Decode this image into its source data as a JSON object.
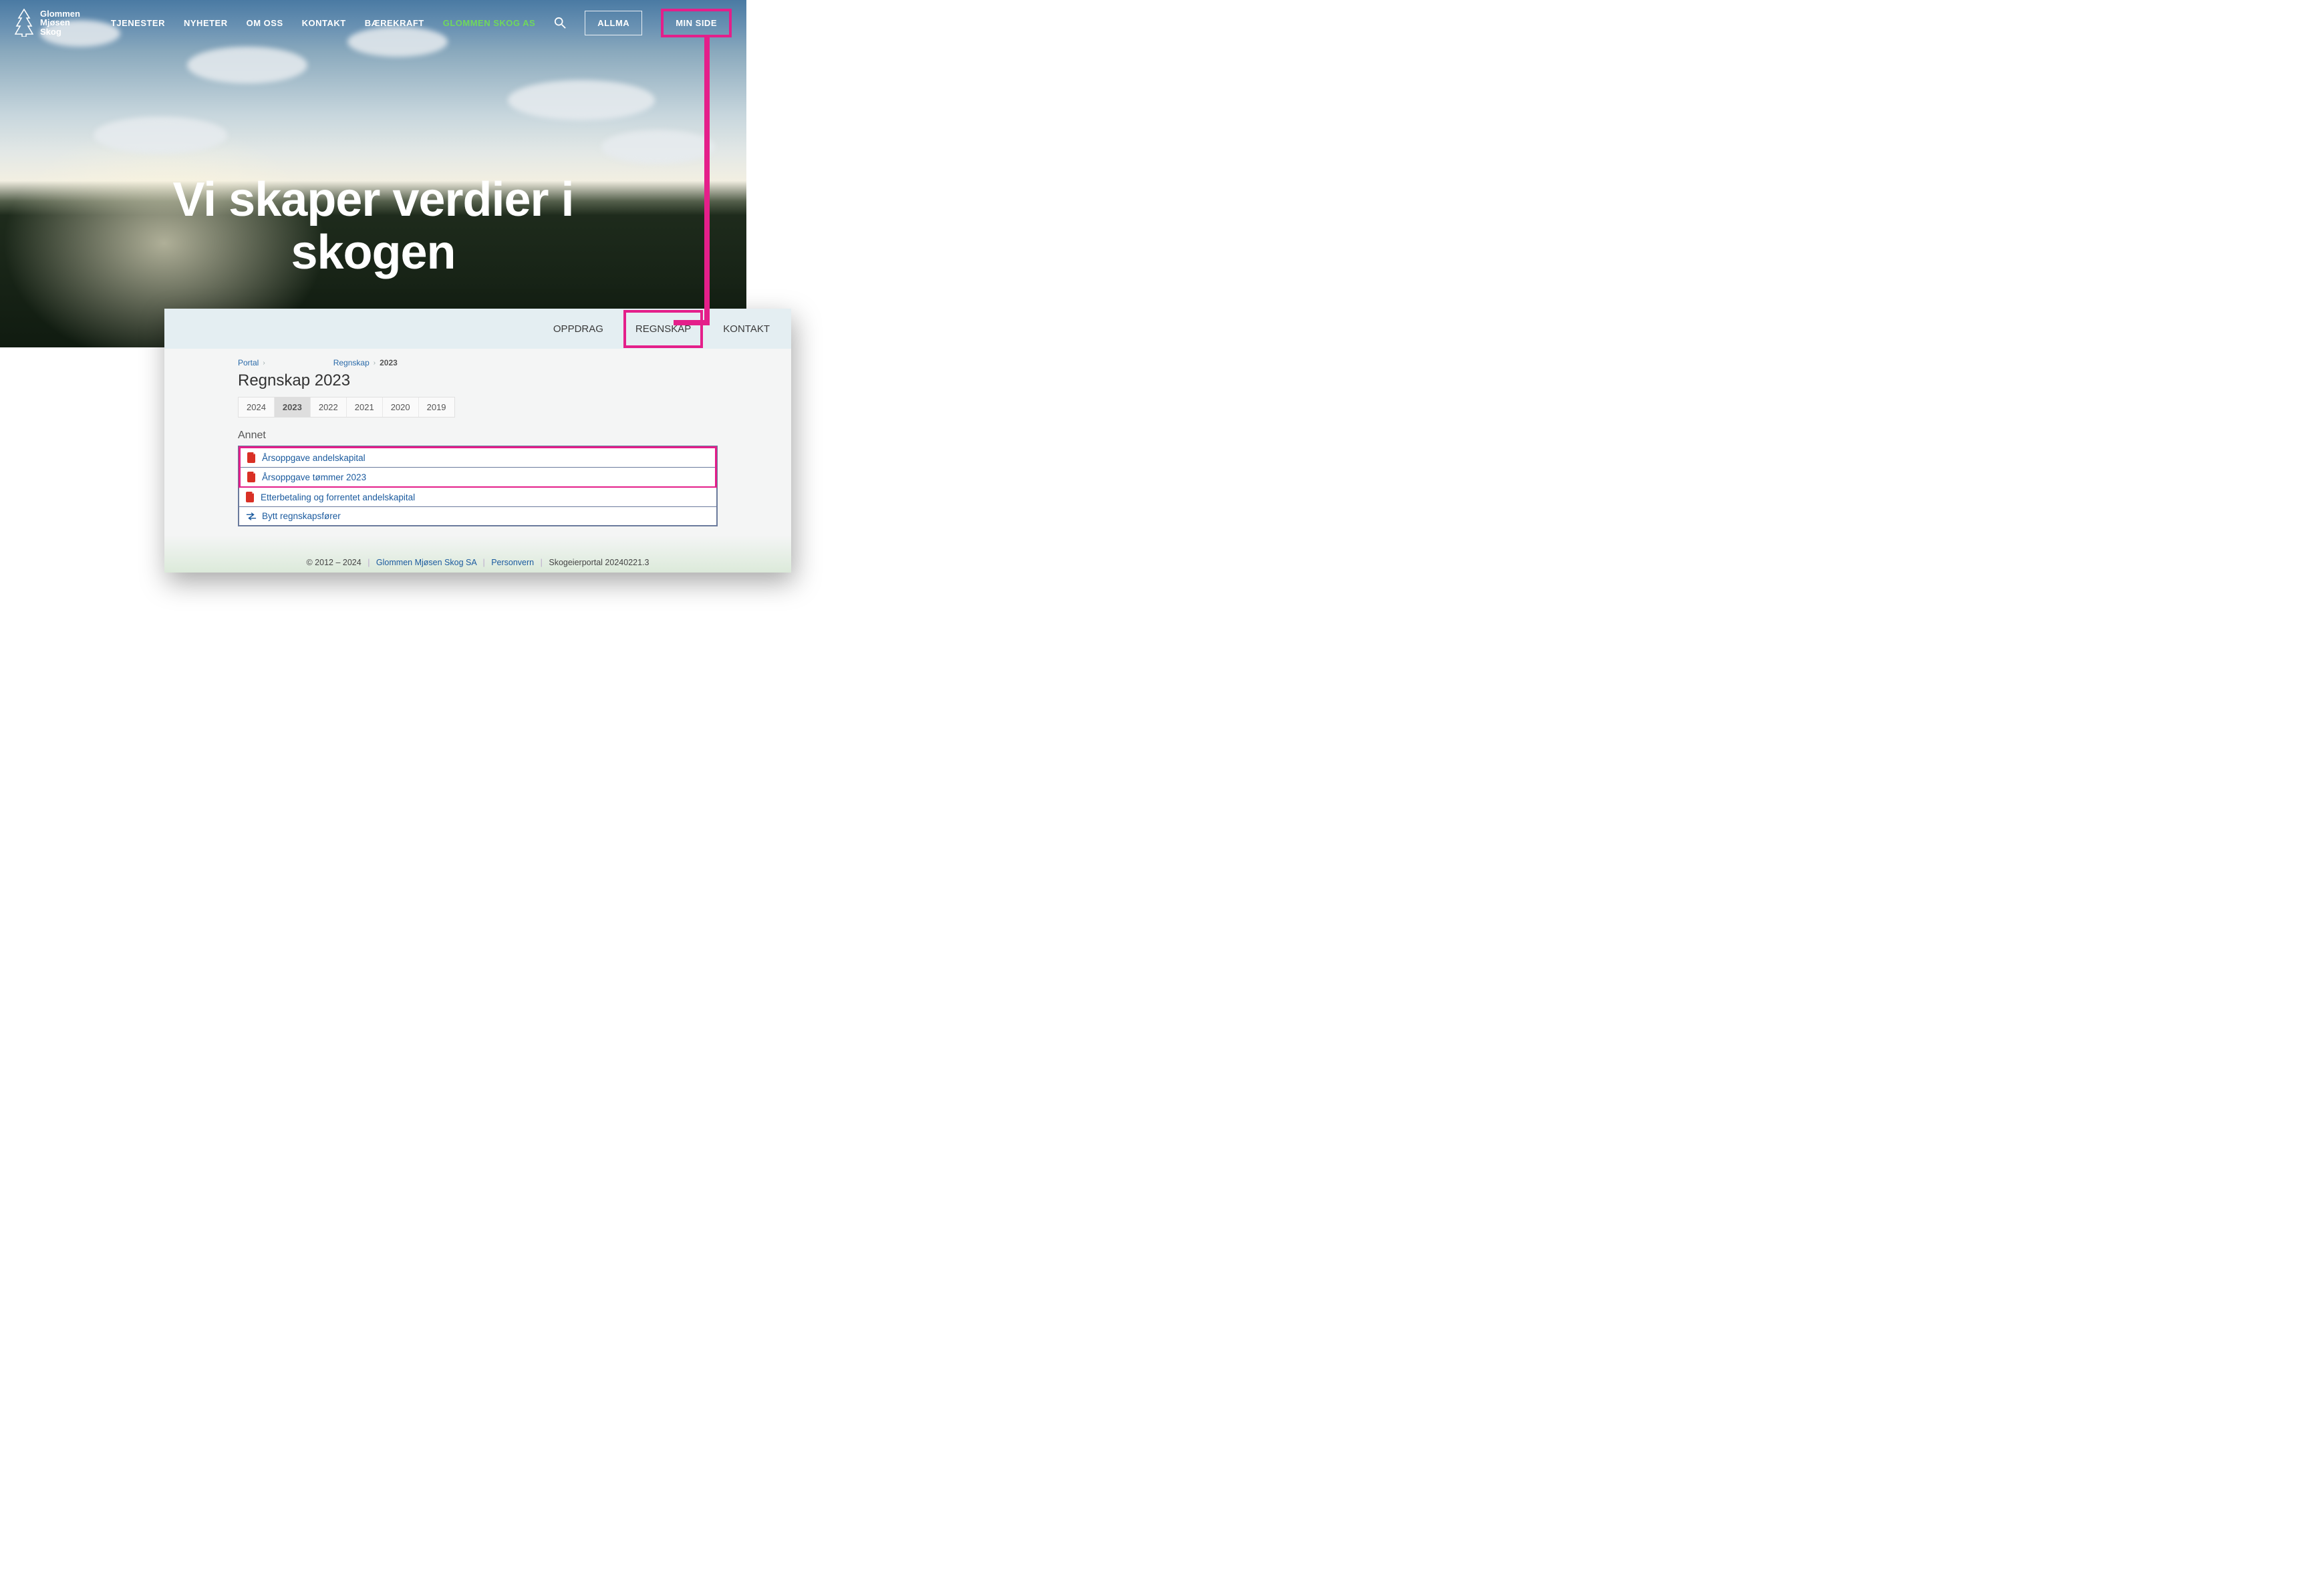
{
  "brand": {
    "line1": "Glommen",
    "line2": "Mjøsen",
    "line3": "Skog"
  },
  "nav": {
    "items": [
      "TJENESTER",
      "NYHETER",
      "OM OSS",
      "KONTAKT",
      "BÆREKRAFT"
    ],
    "green": "GLOMMEN SKOG AS",
    "allma": "ALLMA",
    "minside": "MIN SIDE"
  },
  "hero": {
    "line1": "Vi skaper verdier i",
    "line2": "skogen"
  },
  "portal": {
    "tabs": {
      "oppdrag": "OPPDRAG",
      "regnskap": "REGNSKAP",
      "kontakt": "KONTAKT"
    },
    "breadcrumb": {
      "portal": "Portal",
      "regnskap": "Regnskap",
      "year": "2023"
    },
    "title": "Regnskap 2023",
    "years": [
      "2024",
      "2023",
      "2022",
      "2021",
      "2020",
      "2019"
    ],
    "active_year": "2023",
    "section": "Annet",
    "rows": {
      "r1": "Årsoppgave andelskapital",
      "r2": "Årsoppgave tømmer 2023",
      "r3": "Etterbetaling og forrentet andelskapital",
      "r4": "Bytt regnskapsfører"
    },
    "footer": {
      "copyright": "© 2012 – 2024",
      "org": "Glommen Mjøsen Skog SA",
      "privacy": "Personvern",
      "build": "Skogeierportal 20240221.3"
    }
  }
}
